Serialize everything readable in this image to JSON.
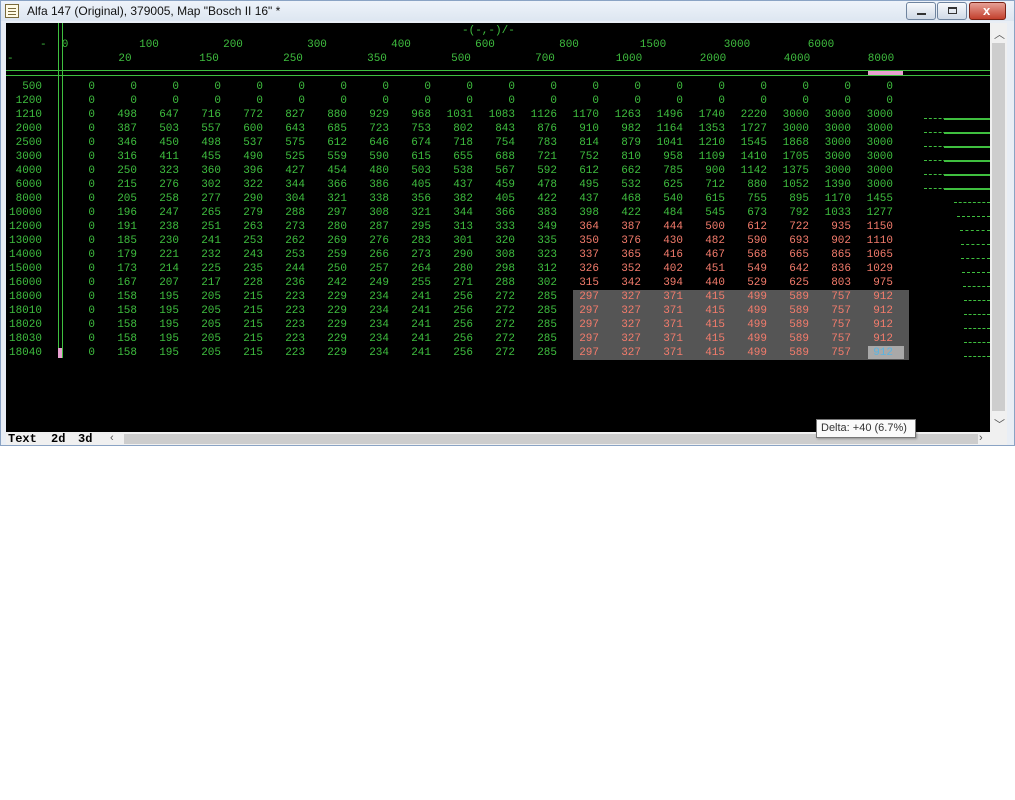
{
  "window": {
    "title": "Alfa 147 (Original), 379005, Map \"Bosch II 16\" *",
    "min_label": "",
    "close_label": "x"
  },
  "map": {
    "axis_label": "-(-,-)/-",
    "corner_top": "-",
    "corner_bottom": "-",
    "columns": [
      "0",
      "20",
      "100",
      "150",
      "200",
      "250",
      "300",
      "350",
      "400",
      "500",
      "600",
      "700",
      "800",
      "1000",
      "1500",
      "2000",
      "3000",
      "4000",
      "6000",
      "8000"
    ],
    "rows": [
      {
        "label": "500",
        "values": [
          "0",
          "0",
          "0",
          "0",
          "0",
          "0",
          "0",
          "0",
          "0",
          "0",
          "0",
          "0",
          "0",
          "0",
          "0",
          "0",
          "0",
          "0",
          "0",
          "0"
        ]
      },
      {
        "label": "1200",
        "values": [
          "0",
          "0",
          "0",
          "0",
          "0",
          "0",
          "0",
          "0",
          "0",
          "0",
          "0",
          "0",
          "0",
          "0",
          "0",
          "0",
          "0",
          "0",
          "0",
          "0"
        ]
      },
      {
        "label": "1210",
        "values": [
          "0",
          "498",
          "647",
          "716",
          "772",
          "827",
          "880",
          "929",
          "968",
          "1031",
          "1083",
          "1126",
          "1170",
          "1263",
          "1496",
          "1740",
          "2220",
          "3000",
          "3000",
          "3000"
        ]
      },
      {
        "label": "2000",
        "values": [
          "0",
          "387",
          "503",
          "557",
          "600",
          "643",
          "685",
          "723",
          "753",
          "802",
          "843",
          "876",
          "910",
          "982",
          "1164",
          "1353",
          "1727",
          "3000",
          "3000",
          "3000"
        ]
      },
      {
        "label": "2500",
        "values": [
          "0",
          "346",
          "450",
          "498",
          "537",
          "575",
          "612",
          "646",
          "674",
          "718",
          "754",
          "783",
          "814",
          "879",
          "1041",
          "1210",
          "1545",
          "1868",
          "3000",
          "3000"
        ]
      },
      {
        "label": "3000",
        "values": [
          "0",
          "316",
          "411",
          "455",
          "490",
          "525",
          "559",
          "590",
          "615",
          "655",
          "688",
          "721",
          "752",
          "810",
          "958",
          "1109",
          "1410",
          "1705",
          "3000",
          "3000"
        ]
      },
      {
        "label": "4000",
        "values": [
          "0",
          "250",
          "323",
          "360",
          "396",
          "427",
          "454",
          "480",
          "503",
          "538",
          "567",
          "592",
          "612",
          "662",
          "785",
          "900",
          "1142",
          "1375",
          "3000",
          "3000"
        ]
      },
      {
        "label": "6000",
        "values": [
          "0",
          "215",
          "276",
          "302",
          "322",
          "344",
          "366",
          "386",
          "405",
          "437",
          "459",
          "478",
          "495",
          "532",
          "625",
          "712",
          "880",
          "1052",
          "1390",
          "3000"
        ]
      },
      {
        "label": "8000",
        "values": [
          "0",
          "205",
          "258",
          "277",
          "290",
          "304",
          "321",
          "338",
          "356",
          "382",
          "405",
          "422",
          "437",
          "468",
          "540",
          "615",
          "755",
          "895",
          "1170",
          "1455"
        ]
      },
      {
        "label": "10000",
        "values": [
          "0",
          "196",
          "247",
          "265",
          "279",
          "288",
          "297",
          "308",
          "321",
          "344",
          "366",
          "383",
          "398",
          "422",
          "484",
          "545",
          "673",
          "792",
          "1033",
          "1277"
        ]
      },
      {
        "label": "12000",
        "values": [
          "0",
          "191",
          "238",
          "251",
          "263",
          "273",
          "280",
          "287",
          "295",
          "313",
          "333",
          "349",
          "364",
          "387",
          "444",
          "500",
          "612",
          "722",
          "935",
          "1150"
        ]
      },
      {
        "label": "13000",
        "values": [
          "0",
          "185",
          "230",
          "241",
          "253",
          "262",
          "269",
          "276",
          "283",
          "301",
          "320",
          "335",
          "350",
          "376",
          "430",
          "482",
          "590",
          "693",
          "902",
          "1110"
        ]
      },
      {
        "label": "14000",
        "values": [
          "0",
          "179",
          "221",
          "232",
          "243",
          "253",
          "259",
          "266",
          "273",
          "290",
          "308",
          "323",
          "337",
          "365",
          "416",
          "467",
          "568",
          "665",
          "865",
          "1065"
        ]
      },
      {
        "label": "15000",
        "values": [
          "0",
          "173",
          "214",
          "225",
          "235",
          "244",
          "250",
          "257",
          "264",
          "280",
          "298",
          "312",
          "326",
          "352",
          "402",
          "451",
          "549",
          "642",
          "836",
          "1029"
        ]
      },
      {
        "label": "16000",
        "values": [
          "0",
          "167",
          "207",
          "217",
          "228",
          "236",
          "242",
          "249",
          "255",
          "271",
          "288",
          "302",
          "315",
          "342",
          "394",
          "440",
          "529",
          "625",
          "803",
          "975"
        ]
      },
      {
        "label": "18000",
        "values": [
          "0",
          "158",
          "195",
          "205",
          "215",
          "223",
          "229",
          "234",
          "241",
          "256",
          "272",
          "285",
          "297",
          "327",
          "371",
          "415",
          "499",
          "589",
          "757",
          "912"
        ]
      },
      {
        "label": "18010",
        "values": [
          "0",
          "158",
          "195",
          "205",
          "215",
          "223",
          "229",
          "234",
          "241",
          "256",
          "272",
          "285",
          "297",
          "327",
          "371",
          "415",
          "499",
          "589",
          "757",
          "912"
        ]
      },
      {
        "label": "18020",
        "values": [
          "0",
          "158",
          "195",
          "205",
          "215",
          "223",
          "229",
          "234",
          "241",
          "256",
          "272",
          "285",
          "297",
          "327",
          "371",
          "415",
          "499",
          "589",
          "757",
          "912"
        ]
      },
      {
        "label": "18030",
        "values": [
          "0",
          "158",
          "195",
          "205",
          "215",
          "223",
          "229",
          "234",
          "241",
          "256",
          "272",
          "285",
          "297",
          "327",
          "371",
          "415",
          "499",
          "589",
          "757",
          "912"
        ]
      },
      {
        "label": "18040",
        "values": [
          "0",
          "158",
          "195",
          "205",
          "215",
          "223",
          "229",
          "234",
          "241",
          "256",
          "272",
          "285",
          "297",
          "327",
          "371",
          "415",
          "499",
          "589",
          "757",
          "912"
        ]
      }
    ],
    "colors": {
      "background": "#000000",
      "value": "#3fbf3f",
      "modified": "#f47c6c",
      "selection": "#555555",
      "cursor": "#a9a9a9"
    }
  },
  "tabs": [
    "Text",
    "2d",
    "3d"
  ],
  "tooltip": {
    "text": "Delta: +40 (6.7%)"
  }
}
